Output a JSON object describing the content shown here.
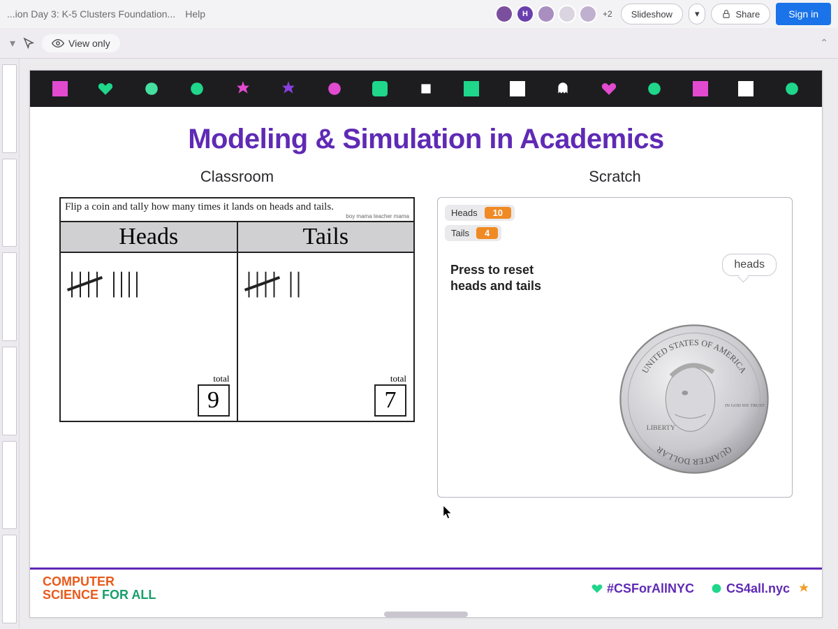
{
  "topbar": {
    "doc_title_partial": "...ion Day 3: K-5 Clusters Foundation...",
    "help_label": "Help",
    "avatar_initial": "H",
    "more_avatars": "+2",
    "slideshow_label": "Slideshow",
    "share_label": "Share",
    "signin_label": "Sign in"
  },
  "toolbar": {
    "view_only_label": "View only"
  },
  "slide": {
    "title": "Modeling & Simulation in Academics",
    "col_left": "Classroom",
    "col_right": "Scratch",
    "worksheet": {
      "instruction": "Flip a coin and tally how many times it lands on heads and tails.",
      "credit": "boy mama teacher mama",
      "head_left": "Heads",
      "head_right": "Tails",
      "total_label": "total",
      "total_heads": "9",
      "total_tails": "7",
      "tally_heads_groups": [
        "5",
        "4"
      ],
      "tally_tails_groups": [
        "5",
        "2"
      ]
    },
    "scratch": {
      "var1_label": "Heads",
      "var1_value": "10",
      "var2_label": "Tails",
      "var2_value": "4",
      "press_text": "Press to reset heads and tails",
      "bubble": "heads",
      "coin_top": "UNITED STATES OF AMERICA",
      "coin_bottom": "QUARTER DOLLAR",
      "coin_left": "LIBERTY",
      "coin_right": "IN GOD WE TRUST"
    },
    "footer": {
      "brand_line1_a": "COMPUTER",
      "brand_line2_a": "SCIENCE",
      "brand_line2_b": " FOR ALL",
      "hashtag": "#CSForAllNYC",
      "site": "CS4all.nyc"
    }
  }
}
